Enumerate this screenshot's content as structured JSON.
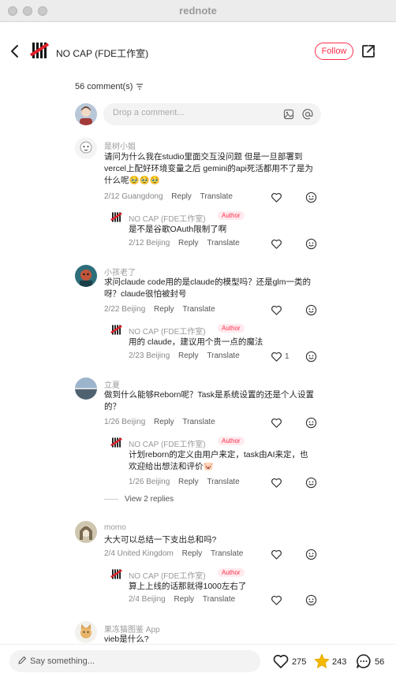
{
  "window": {
    "title": "rednote"
  },
  "header": {
    "author_name": "NO CAP (FDE工作室)",
    "follow_label": "Follow"
  },
  "comments_header": {
    "count_label": "56 comment(s)"
  },
  "comment_input": {
    "placeholder": "Drop a comment..."
  },
  "comments": [
    {
      "nick": "是树小姐",
      "text": "请问为什么我在studio里面交互没问题 但是一旦部署到vercel上配好环境变量之后 gemini的api死活都用不了是为什么呢🥹🥹🥹",
      "date_loc": "2/12 Guangdong",
      "reply_label": "Reply",
      "translate_label": "Translate",
      "replies": [
        {
          "nick": "NO CAP (FDE工作室)",
          "tag": "Author",
          "text": "是不是谷歌OAuth限制了啊",
          "date_loc": "2/12 Beijing",
          "reply_label": "Reply",
          "translate_label": "Translate"
        }
      ]
    },
    {
      "nick": "小孩老了",
      "text": "求问claude code用的是claude的模型吗？还是glm一类的呀？claude很怕被封号",
      "date_loc": "2/22 Beijing",
      "reply_label": "Reply",
      "translate_label": "Translate",
      "replies": [
        {
          "nick": "NO CAP (FDE工作室)",
          "tag": "Author",
          "text": "用的 claude，建议用个贵一点的魔法",
          "date_loc": "2/23 Beijing",
          "reply_label": "Reply",
          "translate_label": "Translate",
          "likes": "1"
        }
      ]
    },
    {
      "nick": "立夏",
      "text": "做到什么能够Reborn呢？Task是系统设置的还是个人设置的？",
      "date_loc": "1/26 Beijing",
      "reply_label": "Reply",
      "translate_label": "Translate",
      "replies": [
        {
          "nick": "NO CAP (FDE工作室)",
          "tag": "Author",
          "text": "计划reborn的定义由用户来定，task由AI来定，也欢迎给出想法和评价🐷",
          "date_loc": "1/26 Beijing",
          "reply_label": "Reply",
          "translate_label": "Translate"
        }
      ],
      "view_replies_label": "View 2 replies"
    },
    {
      "nick": "momo",
      "text": "大大可以总结一下支出总和吗?",
      "date_loc": "2/4 United Kingdom",
      "reply_label": "Reply",
      "translate_label": "Translate",
      "replies": [
        {
          "nick": "NO CAP (FDE工作室)",
          "tag": "Author",
          "text": "算上上线的话那就得1000左右了",
          "date_loc": "2/4 Beijing",
          "reply_label": "Reply",
          "translate_label": "Translate"
        }
      ]
    },
    {
      "nick": "果冻猫图鉴 App",
      "text": "vieb是什么?"
    }
  ],
  "bottom_bar": {
    "say_placeholder": "Say something...",
    "likes": "275",
    "collects": "243",
    "comments": "56"
  },
  "colors": {
    "accent": "#ff2e4d",
    "star": "#f5b800"
  }
}
